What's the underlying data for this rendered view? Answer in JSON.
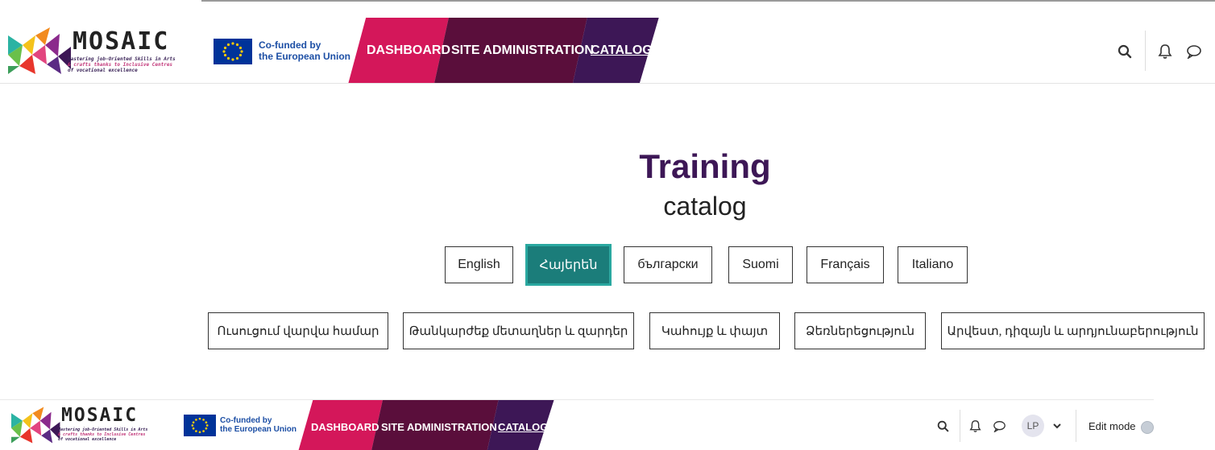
{
  "brand": {
    "name": "MOSAIC",
    "tagline": [
      "Mastering job-Oriented Skills in Arts",
      "& crafts thanks to Inclusive Centres",
      "of vocational excellence"
    ],
    "eu_line1": "Co-funded by",
    "eu_line2": "the European Union"
  },
  "nav": {
    "items": [
      {
        "label": "DASHBOARD",
        "color": "#d4175a"
      },
      {
        "label": "SITE ADMINISTRATION",
        "color": "#5a0e3b"
      },
      {
        "label": "CATALOG",
        "color": "#3d1756",
        "active": true
      }
    ]
  },
  "user": {
    "initials": "LP",
    "edit_mode_label": "Edit mode"
  },
  "page": {
    "title": "Training",
    "subtitle": "catalog"
  },
  "languages": [
    {
      "label": "English"
    },
    {
      "label": "Հայերեն",
      "active": true
    },
    {
      "label": "български"
    },
    {
      "label": "Suomi"
    },
    {
      "label": "Français"
    },
    {
      "label": "Italiano"
    }
  ],
  "categories": [
    {
      "label": "Ուսուցում վարվա համար"
    },
    {
      "label": "Թանկարժեք մետաղներ և զարդեր"
    },
    {
      "label": "Կահույք և փայտ"
    },
    {
      "label": "Ձեռներեցություն"
    },
    {
      "label": "Արվեստ, դիզայն և արդյունաբերություն"
    }
  ],
  "icons": [
    "search-icon",
    "bell-icon",
    "chat-icon",
    "chevron-down-icon"
  ],
  "colors": {
    "accent_teal": "#1b7d7a",
    "title_purple": "#3d1756",
    "magenta": "#d4175a",
    "plum": "#5a0e3b"
  }
}
